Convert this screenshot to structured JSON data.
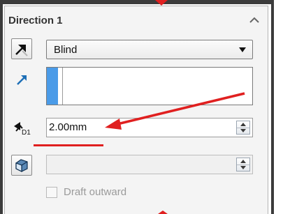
{
  "panel": {
    "title": "Direction 1",
    "end_condition": {
      "selected": "Blind"
    },
    "depth": {
      "value": "2.00mm"
    },
    "draft_angle": {
      "value": ""
    },
    "draft_outward": {
      "label": "Draft outward",
      "checked": false
    }
  },
  "annotations": {
    "color": "#e02020"
  },
  "icons": {
    "collapse": "chevron-up-icon",
    "reverse_direction": "reverse-direction-icon",
    "direction_vector": "direction-arrow-icon",
    "depth": "depth-d1-icon",
    "draft": "draft-icon"
  }
}
